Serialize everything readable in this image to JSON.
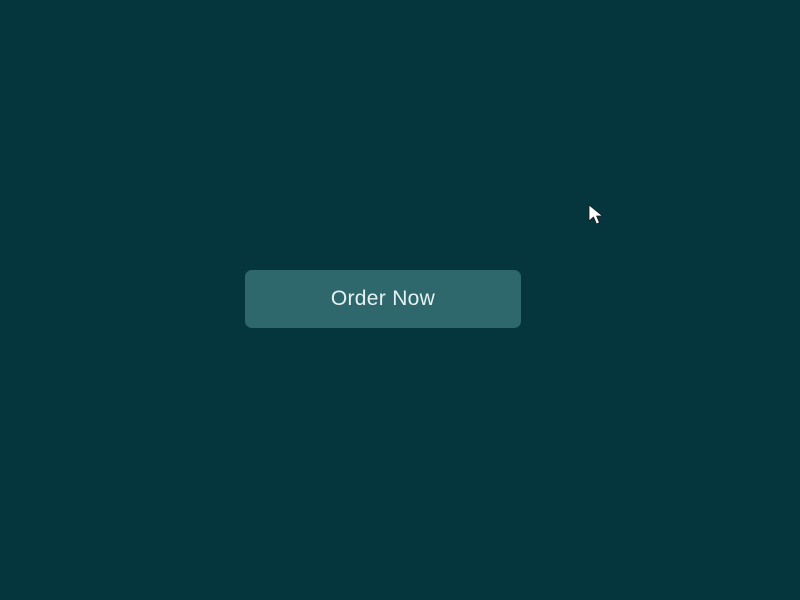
{
  "window": {
    "background_color": "#06363d"
  },
  "button": {
    "label": "Order Now",
    "background_color": "#2e686d",
    "text_color": "#e6f1f1"
  },
  "cursor": {
    "icon": "arrow-pointer-icon",
    "color": "#ffffff"
  }
}
